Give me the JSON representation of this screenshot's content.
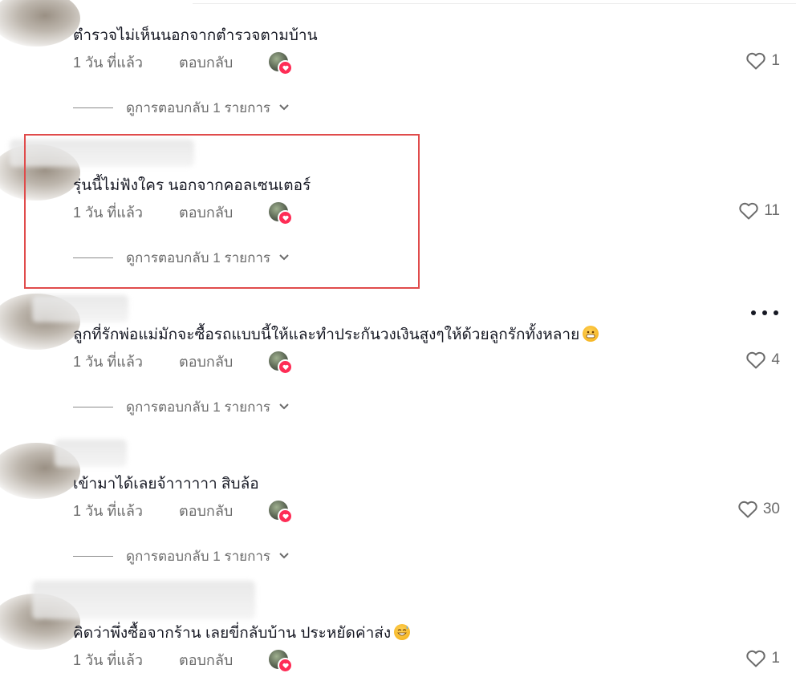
{
  "comments": [
    {
      "text": "ตำรวจไม่เห็นนอกจากตำรวจตามบ้าน",
      "time": "1 วัน ที่แล้ว",
      "reply": "ตอบกลับ",
      "likes": "1",
      "view_replies": "ดูการตอบกลับ 1 รายการ"
    },
    {
      "text": "รุ่นนี้ไม่ฟังใคร นอกจากคอลเซนเตอร์",
      "time": "1 วัน ที่แล้ว",
      "reply": "ตอบกลับ",
      "likes": "11",
      "view_replies": "ดูการตอบกลับ 1 รายการ"
    },
    {
      "text": "ลูกที่รักพ่อแม่มักจะซื้อรถแบบนี้ให้และทำประกันวงเงินสูงๆให้ด้วยลูกรักทั้งหลาย",
      "emoji": "grinning-face-emoji",
      "time": "1 วัน ที่แล้ว",
      "reply": "ตอบกลับ",
      "likes": "4",
      "view_replies": "ดูการตอบกลับ 1 รายการ"
    },
    {
      "text": "เข้ามาได้เลยจ้าาาาาา สิบล้อ",
      "time": "1 วัน ที่แล้ว",
      "reply": "ตอบกลับ",
      "likes": "30",
      "view_replies": "ดูการตอบกลับ 1 รายการ"
    },
    {
      "text": "คิดว่าพึ่งซื้อจากร้าน เลยขี่กลับบ้าน ประหยัดค่าส่ง",
      "emoji": "sweat-smile-emoji",
      "time": "1 วัน ที่แล้ว",
      "reply": "ตอบกลับ",
      "likes": "1"
    }
  ],
  "colors": {
    "highlight_border": "#e04b4b",
    "creator_badge": "#fe2c55",
    "meta_text": "#6b6b6b"
  }
}
